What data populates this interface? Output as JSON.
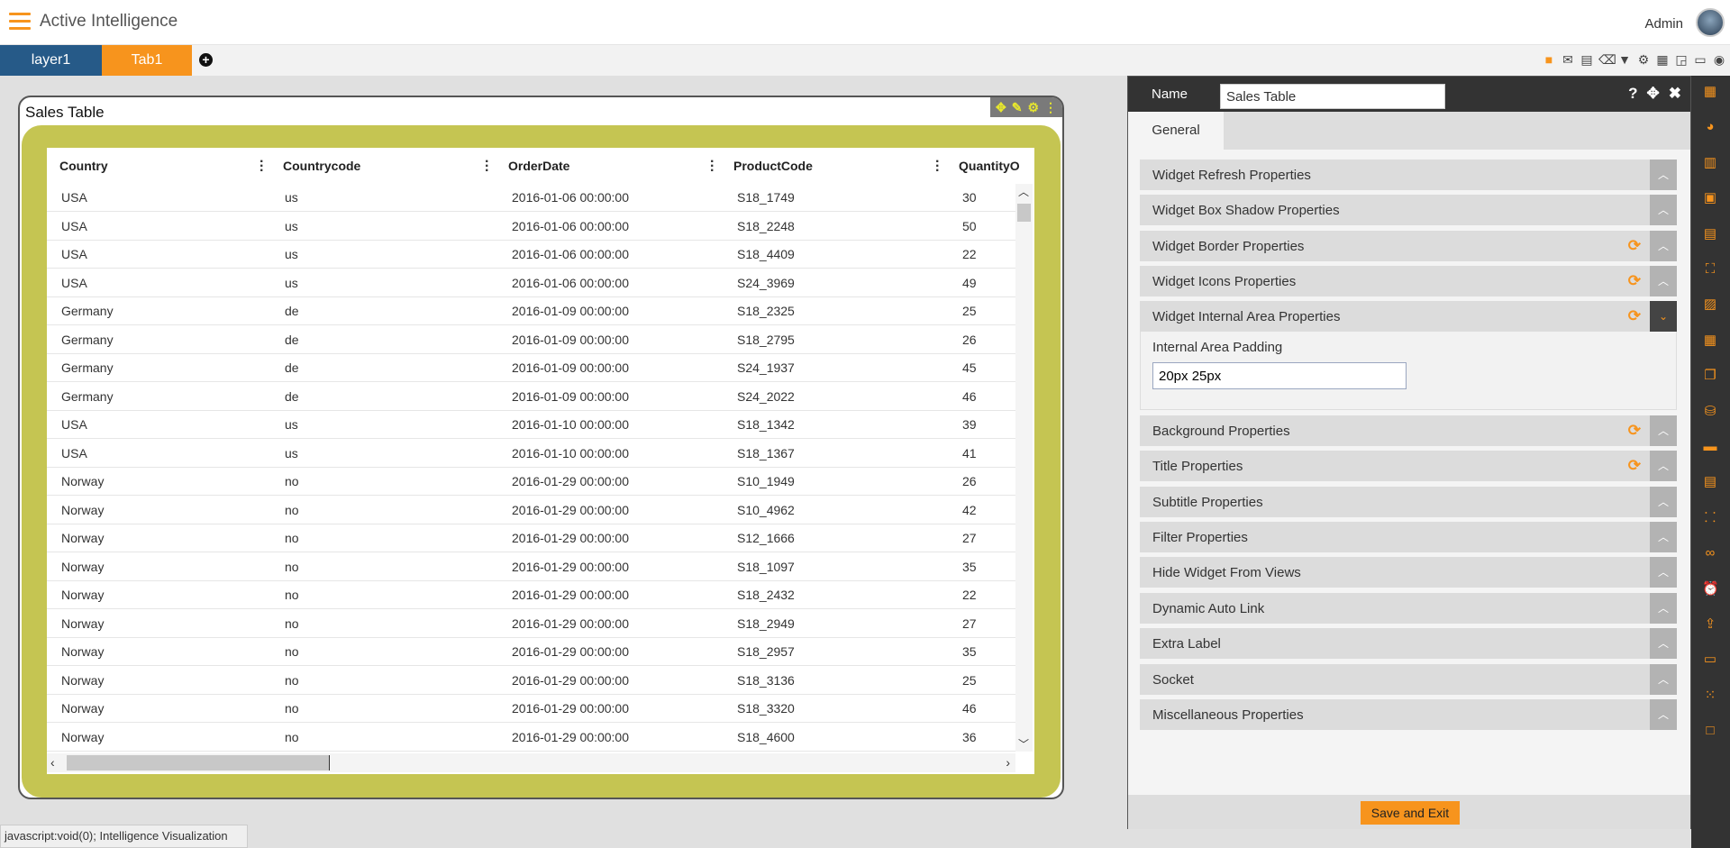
{
  "app": {
    "title": "Active Intelligence",
    "user": "Admin"
  },
  "tabs": [
    {
      "label": "layer1",
      "color": "#265a88"
    },
    {
      "label": "Tab1",
      "color": "#f7941d"
    }
  ],
  "toolbar_icons": [
    "save-icon",
    "mail-icon",
    "comment-icon",
    "eraser-icon",
    "filter-icon",
    "gear-icon",
    "grid-icon",
    "layout-icon",
    "monitor-icon",
    "eye-icon"
  ],
  "widget": {
    "title": "Sales Table",
    "background": "#c5c552",
    "columns": [
      "Country",
      "Countrycode",
      "OrderDate",
      "ProductCode",
      "QuantityO"
    ],
    "rows": [
      [
        "USA",
        "us",
        "2016-01-06 00:00:00",
        "S18_1749",
        "30"
      ],
      [
        "USA",
        "us",
        "2016-01-06 00:00:00",
        "S18_2248",
        "50"
      ],
      [
        "USA",
        "us",
        "2016-01-06 00:00:00",
        "S18_4409",
        "22"
      ],
      [
        "USA",
        "us",
        "2016-01-06 00:00:00",
        "S24_3969",
        "49"
      ],
      [
        "Germany",
        "de",
        "2016-01-09 00:00:00",
        "S18_2325",
        "25"
      ],
      [
        "Germany",
        "de",
        "2016-01-09 00:00:00",
        "S18_2795",
        "26"
      ],
      [
        "Germany",
        "de",
        "2016-01-09 00:00:00",
        "S24_1937",
        "45"
      ],
      [
        "Germany",
        "de",
        "2016-01-09 00:00:00",
        "S24_2022",
        "46"
      ],
      [
        "USA",
        "us",
        "2016-01-10 00:00:00",
        "S18_1342",
        "39"
      ],
      [
        "USA",
        "us",
        "2016-01-10 00:00:00",
        "S18_1367",
        "41"
      ],
      [
        "Norway",
        "no",
        "2016-01-29 00:00:00",
        "S10_1949",
        "26"
      ],
      [
        "Norway",
        "no",
        "2016-01-29 00:00:00",
        "S10_4962",
        "42"
      ],
      [
        "Norway",
        "no",
        "2016-01-29 00:00:00",
        "S12_1666",
        "27"
      ],
      [
        "Norway",
        "no",
        "2016-01-29 00:00:00",
        "S18_1097",
        "35"
      ],
      [
        "Norway",
        "no",
        "2016-01-29 00:00:00",
        "S18_2432",
        "22"
      ],
      [
        "Norway",
        "no",
        "2016-01-29 00:00:00",
        "S18_2949",
        "27"
      ],
      [
        "Norway",
        "no",
        "2016-01-29 00:00:00",
        "S18_2957",
        "35"
      ],
      [
        "Norway",
        "no",
        "2016-01-29 00:00:00",
        "S18_3136",
        "25"
      ],
      [
        "Norway",
        "no",
        "2016-01-29 00:00:00",
        "S18_3320",
        "46"
      ],
      [
        "Norway",
        "no",
        "2016-01-29 00:00:00",
        "S18_4600",
        "36"
      ]
    ]
  },
  "panel": {
    "name_label": "Name",
    "name_value": "Sales Table",
    "tab": "General",
    "sections": [
      {
        "label": "Widget Refresh Properties",
        "refresh": false
      },
      {
        "label": "Widget Box Shadow Properties",
        "refresh": false
      },
      {
        "label": "Widget Border Properties",
        "refresh": true
      },
      {
        "label": "Widget Icons Properties",
        "refresh": true
      },
      {
        "label": "Widget Internal Area Properties",
        "refresh": true,
        "open": true
      },
      {
        "label": "Background Properties",
        "refresh": true
      },
      {
        "label": "Title Properties",
        "refresh": true
      },
      {
        "label": "Subtitle Properties",
        "refresh": false
      },
      {
        "label": "Filter Properties",
        "refresh": false
      },
      {
        "label": "Hide Widget From Views",
        "refresh": false
      },
      {
        "label": "Dynamic Auto Link",
        "refresh": false
      },
      {
        "label": "Extra Label",
        "refresh": false
      },
      {
        "label": "Socket",
        "refresh": false
      },
      {
        "label": "Miscellaneous Properties",
        "refresh": false
      }
    ],
    "padding_label": "Internal Area Padding",
    "padding_value": "20px 25px",
    "save_label": "Save and Exit"
  },
  "right_bar_icons": [
    "table-icon",
    "pie-chart-icon",
    "map-icon",
    "clipboard-icon",
    "document-icon",
    "resize-icon",
    "image-icon",
    "grid-icon",
    "copy-icon",
    "cubes-icon",
    "layout-icon",
    "file-icon",
    "sitemap-icon",
    "handshake-icon",
    "alarm-icon",
    "upload-icon",
    "presentation-icon",
    "dots-grid-icon",
    "square-icon"
  ],
  "status": {
    "link": "javascript:void(0);",
    "text": "Intelligence Visualization"
  },
  "accent": "#f7941d"
}
